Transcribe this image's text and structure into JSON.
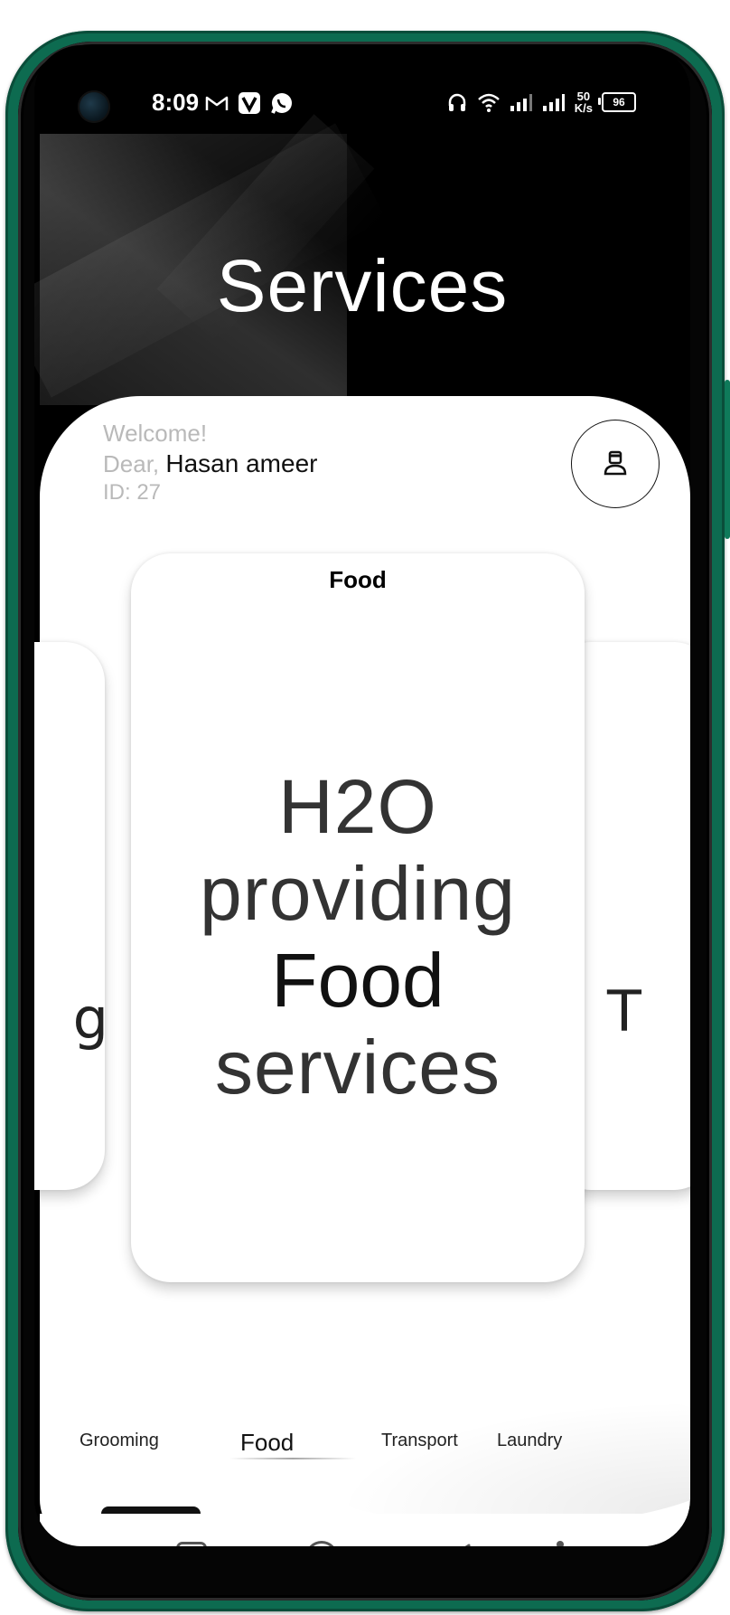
{
  "status_bar": {
    "time": "8:09",
    "left_icons": [
      "gmail-icon",
      "v-app-icon",
      "whatsapp-icon"
    ],
    "right_icons": [
      "headphones-icon",
      "wifi-icon",
      "signal-icon",
      "signal-icon-2"
    ],
    "net_speed_value": "50",
    "net_speed_unit": "K/s",
    "battery": "96"
  },
  "header": {
    "title": "Services"
  },
  "welcome": {
    "greeting": "Welcome!",
    "dear_label": "Dear,",
    "user_name": "Hasan ameer",
    "id_label": "ID: 27"
  },
  "carousel": {
    "active_card": {
      "title": "Food",
      "line1": "H2O",
      "line2": "providing",
      "line3": "Food",
      "line4": "services"
    },
    "left_peek_text": "g",
    "right_peek_text": "T"
  },
  "tabs": [
    {
      "label": "Grooming",
      "active": false
    },
    {
      "label": "Food",
      "active": true
    },
    {
      "label": "Transport",
      "active": false
    },
    {
      "label": "Laundry",
      "active": false
    }
  ],
  "nav": [
    "recent-apps",
    "home",
    "back",
    "accessibility"
  ],
  "colors": {
    "phone_frame": "#0d6b50",
    "sheet": "#ffffff",
    "screen_bg": "#000000"
  }
}
